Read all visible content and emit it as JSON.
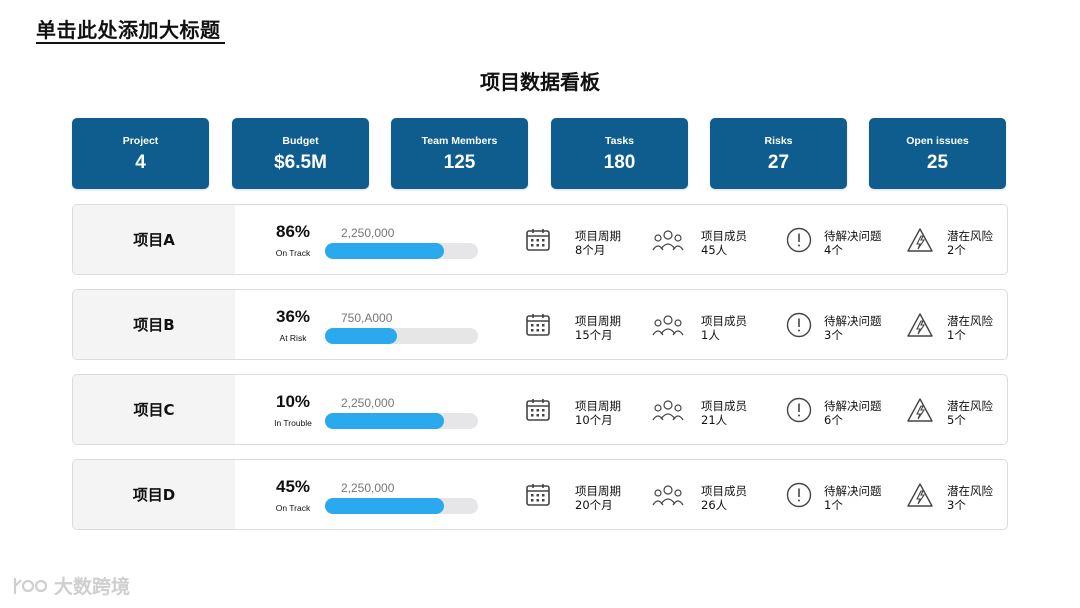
{
  "page": {
    "title": "单击此处添加大标题",
    "board_title": "项目数据看板",
    "watermark": "大数跨境"
  },
  "kpis": [
    {
      "label": "Project",
      "value": "4"
    },
    {
      "label": "Budget",
      "value": "$6.5M"
    },
    {
      "label": "Team Members",
      "value": "125"
    },
    {
      "label": "Tasks",
      "value": "180"
    },
    {
      "label": "Risks",
      "value": "27"
    },
    {
      "label": "Open issues",
      "value": "25"
    }
  ],
  "metric_labels": {
    "period": "项目周期",
    "members": "项目成员",
    "issues": "待解决问题",
    "risks": "潜在风险"
  },
  "projects": [
    {
      "name": "项目A",
      "percent": "86%",
      "progress": 0.78,
      "status": "On Track",
      "amount": "2,250,000",
      "period": "8个月",
      "members": "45人",
      "issues": "4个",
      "risks": "2个"
    },
    {
      "name": "项目B",
      "percent": "36%",
      "progress": 0.47,
      "status": "At Risk",
      "amount": "750,A000",
      "period": "15个月",
      "members": "1人",
      "issues": "3个",
      "risks": "1个"
    },
    {
      "name": "项目C",
      "percent": "10%",
      "progress": 0.78,
      "status": "In Trouble",
      "amount": "2,250,000",
      "period": "10个月",
      "members": "21人",
      "issues": "6个",
      "risks": "5个"
    },
    {
      "name": "项目D",
      "percent": "45%",
      "progress": 0.78,
      "status": "On Track",
      "amount": "2,250,000",
      "period": "20个月",
      "members": "26人",
      "issues": "1个",
      "risks": "3个"
    }
  ],
  "colors": {
    "kpi_bg": "#0f5d8f",
    "bar_fill": "#2aa9ee",
    "bar_track": "#e6e6e9"
  },
  "icons": {
    "period": "calendar-icon",
    "members": "team-icon",
    "issues": "alert-circle-icon",
    "risks": "lightning-warning-icon"
  }
}
